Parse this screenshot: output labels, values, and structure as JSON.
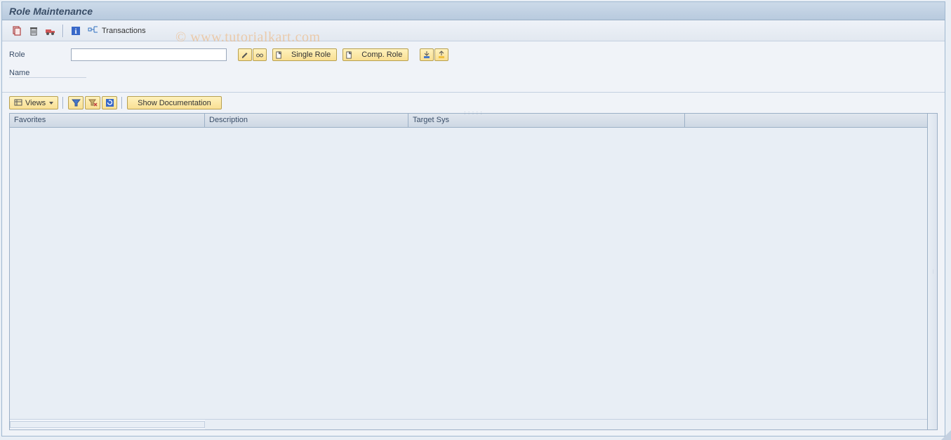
{
  "title": "Role Maintenance",
  "toolbar": {
    "transactions_label": "Transactions"
  },
  "form": {
    "role_label": "Role",
    "role_value": "",
    "name_label": "Name",
    "single_role_label": "Single Role",
    "comp_role_label": "Comp. Role"
  },
  "alv": {
    "views_label": "Views",
    "show_doc_label": "Show Documentation"
  },
  "table": {
    "columns": [
      "Favorites",
      "Description",
      "Target Sys",
      ""
    ]
  },
  "watermark": "© www.tutorialkart.com"
}
